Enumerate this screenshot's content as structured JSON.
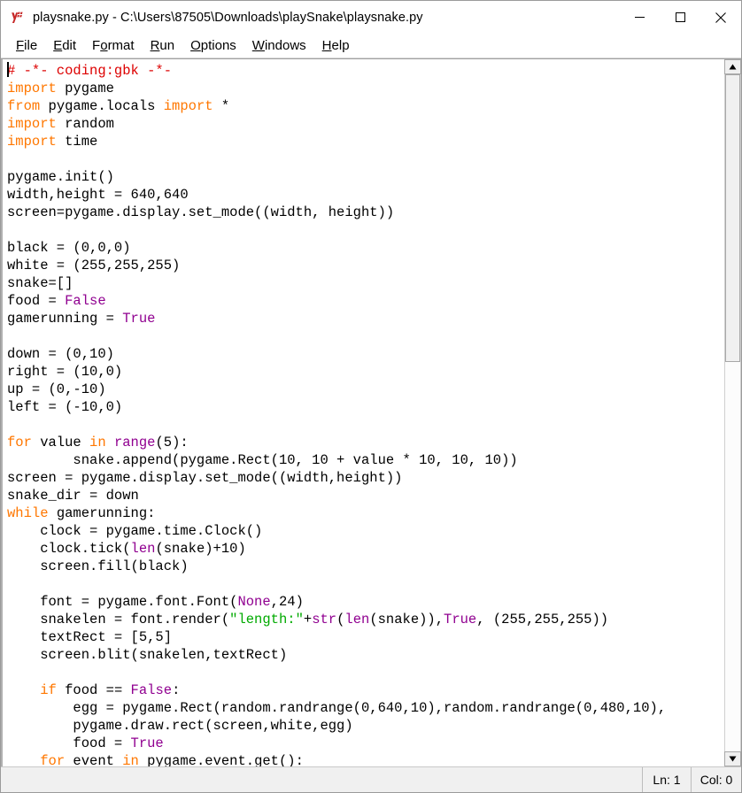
{
  "window": {
    "title": "playsnake.py - C:\\Users\\87505\\Downloads\\playSnake\\playsnake.py",
    "icon": "python-idle-icon",
    "controls": {
      "minimize": "—",
      "maximize": "☐",
      "close": "✕"
    }
  },
  "menu": {
    "items": [
      {
        "label": "File",
        "accel": "F",
        "pre": "",
        "post": "ile"
      },
      {
        "label": "Edit",
        "accel": "E",
        "pre": "",
        "post": "dit"
      },
      {
        "label": "Format",
        "accel": "o",
        "pre": "F",
        "post": "rmat"
      },
      {
        "label": "Run",
        "accel": "R",
        "pre": "",
        "post": "un"
      },
      {
        "label": "Options",
        "accel": "O",
        "pre": "",
        "post": "ptions"
      },
      {
        "label": "Windows",
        "accel": "W",
        "pre": "",
        "post": "indows"
      },
      {
        "label": "Help",
        "accel": "H",
        "pre": "",
        "post": "elp"
      }
    ]
  },
  "colors": {
    "keyword": "#ff7700",
    "builtin": "#900090",
    "string": "#00aa00",
    "comment": "#dd0000",
    "definition": "#0000ff",
    "text": "#000000",
    "background": "#ffffff",
    "chrome": "#f0f0f0"
  },
  "editor": {
    "language": "python",
    "caret": {
      "line": 1,
      "column": 0
    },
    "lines": [
      [
        {
          "t": "# -*- coding:gbk -*-",
          "c": "cmt"
        }
      ],
      [
        {
          "t": "import",
          "c": "kw"
        },
        {
          "t": " pygame",
          "c": ""
        }
      ],
      [
        {
          "t": "from",
          "c": "kw"
        },
        {
          "t": " pygame.locals ",
          "c": ""
        },
        {
          "t": "import",
          "c": "kw"
        },
        {
          "t": " *",
          "c": ""
        }
      ],
      [
        {
          "t": "import",
          "c": "kw"
        },
        {
          "t": " random",
          "c": ""
        }
      ],
      [
        {
          "t": "import",
          "c": "kw"
        },
        {
          "t": " time",
          "c": ""
        }
      ],
      [],
      [
        {
          "t": "pygame.init()",
          "c": ""
        }
      ],
      [
        {
          "t": "width,height = 640,640",
          "c": ""
        }
      ],
      [
        {
          "t": "screen=pygame.display.set_mode((width, height))",
          "c": ""
        }
      ],
      [],
      [
        {
          "t": "black = (0,0,0)",
          "c": ""
        }
      ],
      [
        {
          "t": "white = (255,255,255)",
          "c": ""
        }
      ],
      [
        {
          "t": "snake=[]",
          "c": ""
        }
      ],
      [
        {
          "t": "food = ",
          "c": ""
        },
        {
          "t": "False",
          "c": "bi"
        }
      ],
      [
        {
          "t": "gamerunning = ",
          "c": ""
        },
        {
          "t": "True",
          "c": "bi"
        }
      ],
      [],
      [
        {
          "t": "down = (0,10)",
          "c": ""
        }
      ],
      [
        {
          "t": "right = (10,0)",
          "c": ""
        }
      ],
      [
        {
          "t": "up = (0,-10)",
          "c": ""
        }
      ],
      [
        {
          "t": "left = (-10,0)",
          "c": ""
        }
      ],
      [],
      [
        {
          "t": "for",
          "c": "kw"
        },
        {
          "t": " value ",
          "c": ""
        },
        {
          "t": "in",
          "c": "kw"
        },
        {
          "t": " ",
          "c": ""
        },
        {
          "t": "range",
          "c": "bi"
        },
        {
          "t": "(5):",
          "c": ""
        }
      ],
      [
        {
          "t": "        snake.append(pygame.Rect(10, 10 + value * 10, 10, 10))",
          "c": ""
        }
      ],
      [
        {
          "t": "screen = pygame.display.set_mode((width,height))",
          "c": ""
        }
      ],
      [
        {
          "t": "snake_dir = down",
          "c": ""
        }
      ],
      [
        {
          "t": "while",
          "c": "kw"
        },
        {
          "t": " gamerunning:",
          "c": ""
        }
      ],
      [
        {
          "t": "    clock = pygame.time.Clock()",
          "c": ""
        }
      ],
      [
        {
          "t": "    clock.tick(",
          "c": ""
        },
        {
          "t": "len",
          "c": "bi"
        },
        {
          "t": "(snake)+10)",
          "c": ""
        }
      ],
      [
        {
          "t": "    screen.fill(black)",
          "c": ""
        }
      ],
      [],
      [
        {
          "t": "    font = pygame.font.Font(",
          "c": ""
        },
        {
          "t": "None",
          "c": "bi"
        },
        {
          "t": ",24)",
          "c": ""
        }
      ],
      [
        {
          "t": "    snakelen = font.render(",
          "c": ""
        },
        {
          "t": "\"length:\"",
          "c": "str"
        },
        {
          "t": "+",
          "c": ""
        },
        {
          "t": "str",
          "c": "bi"
        },
        {
          "t": "(",
          "c": ""
        },
        {
          "t": "len",
          "c": "bi"
        },
        {
          "t": "(snake)),",
          "c": ""
        },
        {
          "t": "True",
          "c": "bi"
        },
        {
          "t": ", (255,255,255))",
          "c": ""
        }
      ],
      [
        {
          "t": "    textRect = [5,5]",
          "c": ""
        }
      ],
      [
        {
          "t": "    screen.blit(snakelen,textRect)",
          "c": ""
        }
      ],
      [],
      [
        {
          "t": "    ",
          "c": ""
        },
        {
          "t": "if",
          "c": "kw"
        },
        {
          "t": " food == ",
          "c": ""
        },
        {
          "t": "False",
          "c": "bi"
        },
        {
          "t": ":",
          "c": ""
        }
      ],
      [
        {
          "t": "        egg = pygame.Rect(random.randrange(0,640,10),random.randrange(0,480,10),",
          "c": ""
        }
      ],
      [
        {
          "t": "        pygame.draw.rect(screen,white,egg)",
          "c": ""
        }
      ],
      [
        {
          "t": "        food = ",
          "c": ""
        },
        {
          "t": "True",
          "c": "bi"
        }
      ],
      [
        {
          "t": "    ",
          "c": ""
        },
        {
          "t": "for",
          "c": "kw"
        },
        {
          "t": " event ",
          "c": ""
        },
        {
          "t": "in",
          "c": "kw"
        },
        {
          "t": " pygame.event.get():",
          "c": ""
        }
      ]
    ]
  },
  "scrollbar": {
    "up_arrow": "▲",
    "down_arrow": "▼",
    "thumb_top_percent": 0,
    "thumb_height_percent": 42.5
  },
  "status_bar": {
    "line_label": "Ln: 1",
    "col_label": "Col: 0"
  }
}
